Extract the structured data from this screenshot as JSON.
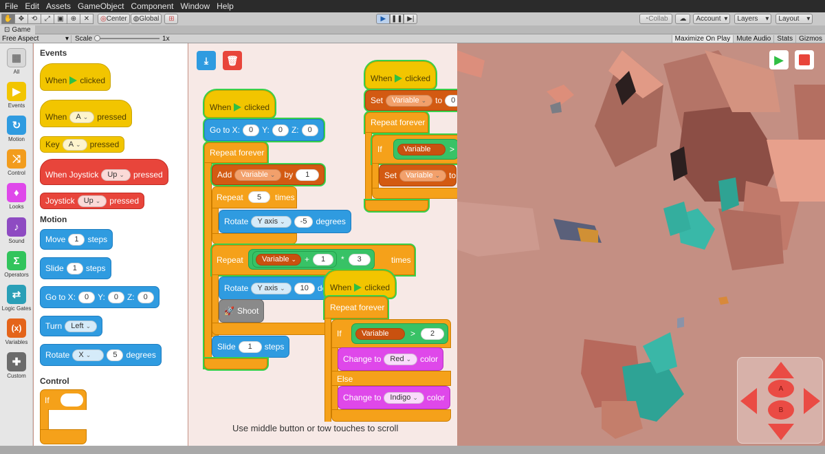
{
  "menu": [
    "File",
    "Edit",
    "Assets",
    "GameObject",
    "Component",
    "Window",
    "Help"
  ],
  "toolbar": {
    "center": "Center",
    "global": "Global",
    "collab": "Collab",
    "account": "Account",
    "layers": "Layers",
    "layout": "Layout"
  },
  "gametab": {
    "title": "Game"
  },
  "options": {
    "aspect": "Free Aspect",
    "scale_label": "Scale",
    "scale_value": "1x",
    "maximize": "Maximize On Play",
    "mute": "Mute Audio",
    "stats": "Stats",
    "gizmos": "Gizmos"
  },
  "categories": [
    {
      "label": "All",
      "icon": "grid-icon",
      "color": "#d8d8d8"
    },
    {
      "label": "Events",
      "icon": "flag-icon",
      "color": "#f2c500"
    },
    {
      "label": "Motion",
      "icon": "rotate-icon",
      "color": "#2f9be0"
    },
    {
      "label": "Control",
      "icon": "shuffle-icon",
      "color": "#f29c1d"
    },
    {
      "label": "Looks",
      "icon": "drop-icon",
      "color": "#df48ea"
    },
    {
      "label": "Sound",
      "icon": "note-icon",
      "color": "#8e4bc2"
    },
    {
      "label": "Operators",
      "icon": "sigma-icon",
      "color": "#32c45c"
    },
    {
      "label": "Logic Gates",
      "icon": "gate-icon",
      "color": "#2a9fb7"
    },
    {
      "label": "Variables",
      "icon": "variable-icon",
      "color": "#e4641a"
    },
    {
      "label": "Custom",
      "icon": "plus-grid-icon",
      "color": "#6b6b6b"
    }
  ],
  "palette": {
    "events": "Events",
    "motion": "Motion",
    "control": "Control",
    "when": "When",
    "clicked": "clicked",
    "pressed": "pressed",
    "key": "Key",
    "a": "A",
    "when_joystick": "When Joystick",
    "joystick": "Joystick",
    "up": "Up",
    "move": "Move",
    "steps": "steps",
    "one": "1",
    "slide": "Slide",
    "goto": "Go to X:",
    "y": "Y:",
    "z": "Z:",
    "zero": "0",
    "turn": "Turn",
    "left": "Left",
    "rotate": "Rotate",
    "x": "X",
    "five": "5",
    "degrees": "degrees",
    "if": "If"
  },
  "script": {
    "when": "When",
    "clicked": "clicked",
    "goto": "Go to X:",
    "y": "Y:",
    "z": "Z:",
    "zero": "0",
    "repeat_forever": "Repeat forever",
    "add": "Add",
    "variable": "Variable",
    "by": "by",
    "one": "1",
    "repeat": "Repeat",
    "five": "5",
    "times": "times",
    "rotate": "Rotate",
    "yaxis": "Y axis",
    "neg5": "-5",
    "degrees": "degrees",
    "plus": "+",
    "mul": "*",
    "three": "3",
    "ten": "10",
    "shoot": "Shoot",
    "slide": "Slide",
    "steps": "steps",
    "set": "Set",
    "to": "to",
    "if": "If",
    "gt": ">",
    "two": "2",
    "change_to": "Change to",
    "red": "Red",
    "color": "color",
    "else": "Else",
    "indigo": "Indigo",
    "hint": "Use middle button or tow touches to scroll"
  },
  "pad": {
    "a": "A",
    "b": "B"
  }
}
